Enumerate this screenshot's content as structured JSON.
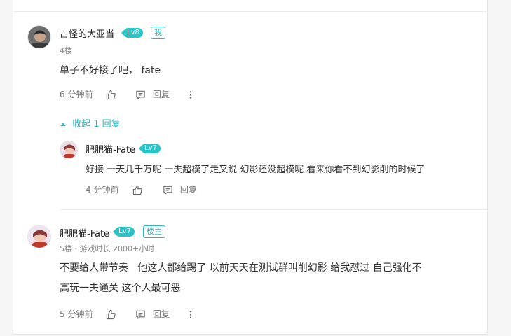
{
  "comments": [
    {
      "username": "古怪的大亚当",
      "level": "Lv8",
      "tag": "我",
      "floor": "4楼",
      "content": "单子不好接了吧， fate",
      "time": "6 分钟前",
      "reply_label": "回复",
      "collapse_label": "收起 1 回复",
      "replies": [
        {
          "username": "肥肥猫-Fate",
          "level": "Lv7",
          "content": "好接 一天几千万呢 一夫超模了走叉说 幻影还没超模呢 看来你看不到幻影削的时候了",
          "time": "4 分钟前",
          "reply_label": "回复"
        }
      ]
    },
    {
      "username": "肥肥猫-Fate",
      "level": "Lv7",
      "tag": "楼主",
      "floor": "5楼 · 游戏时长 2000+小时",
      "content_line1": "不要给人带节奏   他这人都给踢了 以前天天在测试群叫削幻影 给我怼过 自己强化不",
      "content_line2": "高玩一夫通关 这个人最可恶",
      "time": "5 分钟前",
      "reply_label": "回复"
    }
  ],
  "colors": {
    "accent": "#22b8be",
    "badge": "#29c4c9"
  }
}
